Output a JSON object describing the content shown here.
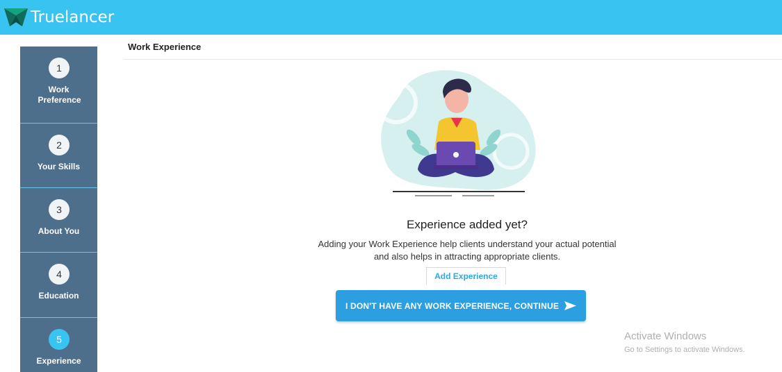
{
  "header": {
    "brand": "Truelancer",
    "logo_icon": "truelancer-logo-icon",
    "bar_color": "#39c3f0"
  },
  "sidebar": {
    "steps": [
      {
        "number": "1",
        "label": "Work Preference"
      },
      {
        "number": "2",
        "label": "Your Skills"
      },
      {
        "number": "3",
        "label": "About You"
      },
      {
        "number": "4",
        "label": "Education"
      },
      {
        "number": "5",
        "label": "Experience",
        "active": true
      }
    ],
    "bg_color": "#4e6f8c"
  },
  "main": {
    "section_title": "Work Experience",
    "empty_state": {
      "illustration": "person-with-laptop-illustration",
      "heading": "Experience added yet?",
      "description_line1": "Adding your Work Experience help clients understand your actual potential",
      "description_line2": "and also helps in attracting appropriate clients.",
      "add_button": "Add Experience",
      "continue_button": "I DON'T HAVE ANY WORK EXPERIENCE, CONTINUE",
      "continue_icon": "send-arrow-icon"
    }
  },
  "watermark": {
    "title": "Activate Windows",
    "subtitle": "Go to Settings to activate Windows."
  }
}
